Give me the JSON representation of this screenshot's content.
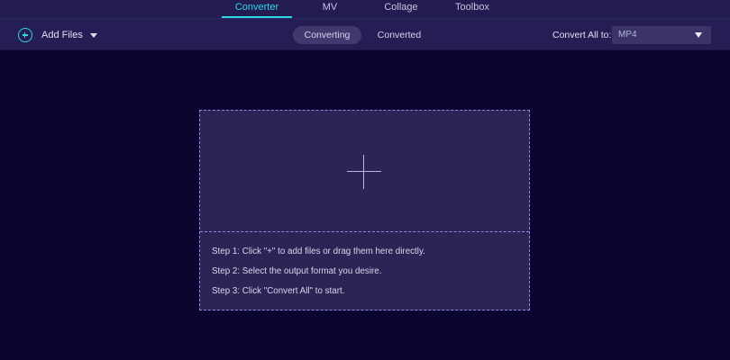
{
  "top_nav": {
    "tabs": [
      {
        "label": "Converter",
        "active": true
      },
      {
        "label": "MV",
        "active": false
      },
      {
        "label": "Collage",
        "active": false
      },
      {
        "label": "Toolbox",
        "active": false
      }
    ]
  },
  "toolbar": {
    "add_files_label": "Add Files",
    "segment_tabs": [
      {
        "label": "Converting",
        "active": true
      },
      {
        "label": "Converted",
        "active": false
      }
    ],
    "convert_all_label": "Convert All to:",
    "format_selected": "MP4"
  },
  "drop_zone": {
    "steps": [
      "Step 1: Click \"+\" to add files or drag them here directly.",
      "Step 2: Select the output format you desire.",
      "Step 3: Click \"Convert All\" to start."
    ]
  },
  "icons": {
    "add_files": "plus-circle-icon",
    "add_files_dropdown": "caret-down-icon",
    "format_dropdown": "caret-down-icon",
    "drop_zone_add": "plus-icon"
  },
  "colors": {
    "background": "#0b0630",
    "toolbar": "#241e54",
    "accent": "#2ed7e6",
    "drop_zone_fill": "#2b2454",
    "drop_zone_border": "#8f86e0"
  }
}
